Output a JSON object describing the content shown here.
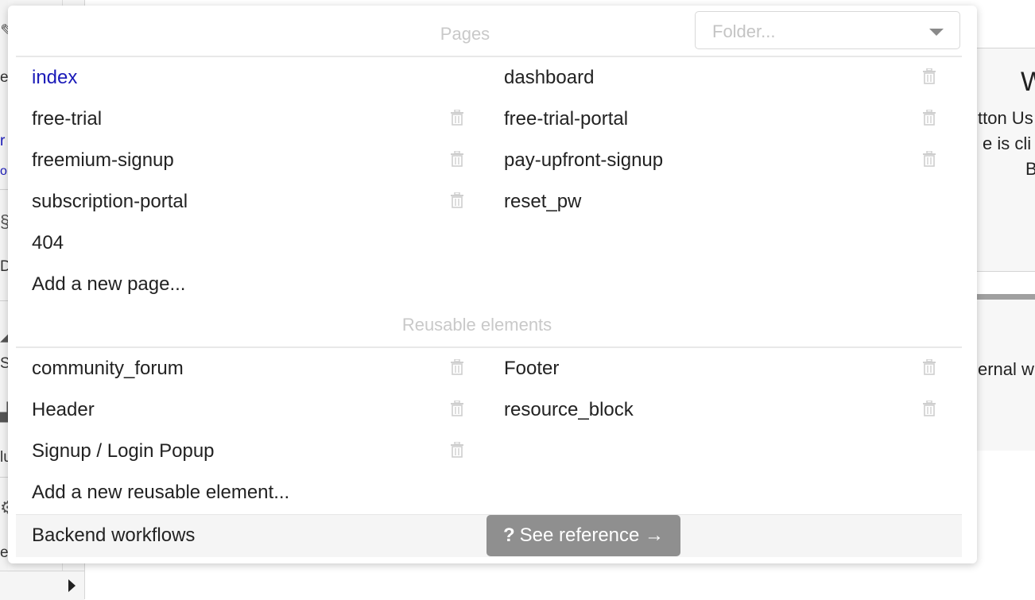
{
  "background": {
    "sidebar_fragments": [
      "e",
      "r",
      "or",
      "D",
      "St",
      "lu",
      "et"
    ],
    "right_panel": {
      "title_fragment": "W",
      "lines": [
        "tton Us",
        "e is cli",
        "B"
      ],
      "lower_fragment": "ernal w"
    }
  },
  "folder_select": {
    "placeholder": "Folder..."
  },
  "pages": {
    "title": "Pages",
    "left": [
      {
        "label": "index",
        "selected": true,
        "deletable": false
      },
      {
        "label": "free-trial",
        "deletable": true
      },
      {
        "label": "freemium-signup",
        "deletable": true
      },
      {
        "label": "subscription-portal",
        "deletable": true
      },
      {
        "label": "404",
        "deletable": false
      }
    ],
    "right": [
      {
        "label": "dashboard",
        "deletable": true
      },
      {
        "label": "free-trial-portal",
        "deletable": true
      },
      {
        "label": "pay-upfront-signup",
        "deletable": true
      },
      {
        "label": "reset_pw",
        "deletable": false
      }
    ],
    "add_label": "Add a new page..."
  },
  "reusable": {
    "title": "Reusable elements",
    "left": [
      {
        "label": "community_forum",
        "deletable": true
      },
      {
        "label": "Header",
        "deletable": true
      },
      {
        "label": "Signup / Login Popup",
        "deletable": true
      }
    ],
    "right": [
      {
        "label": "Footer",
        "deletable": true
      },
      {
        "label": "resource_block",
        "deletable": true
      }
    ],
    "add_label": "Add a new reusable element..."
  },
  "footer": {
    "backend_label": "Backend workflows",
    "reference_button": "See reference →",
    "reference_icon": "?"
  },
  "colors": {
    "selected_text": "#1a1ab8",
    "muted_title": "#c9c9c9",
    "button_bg": "#8f8f8f"
  }
}
